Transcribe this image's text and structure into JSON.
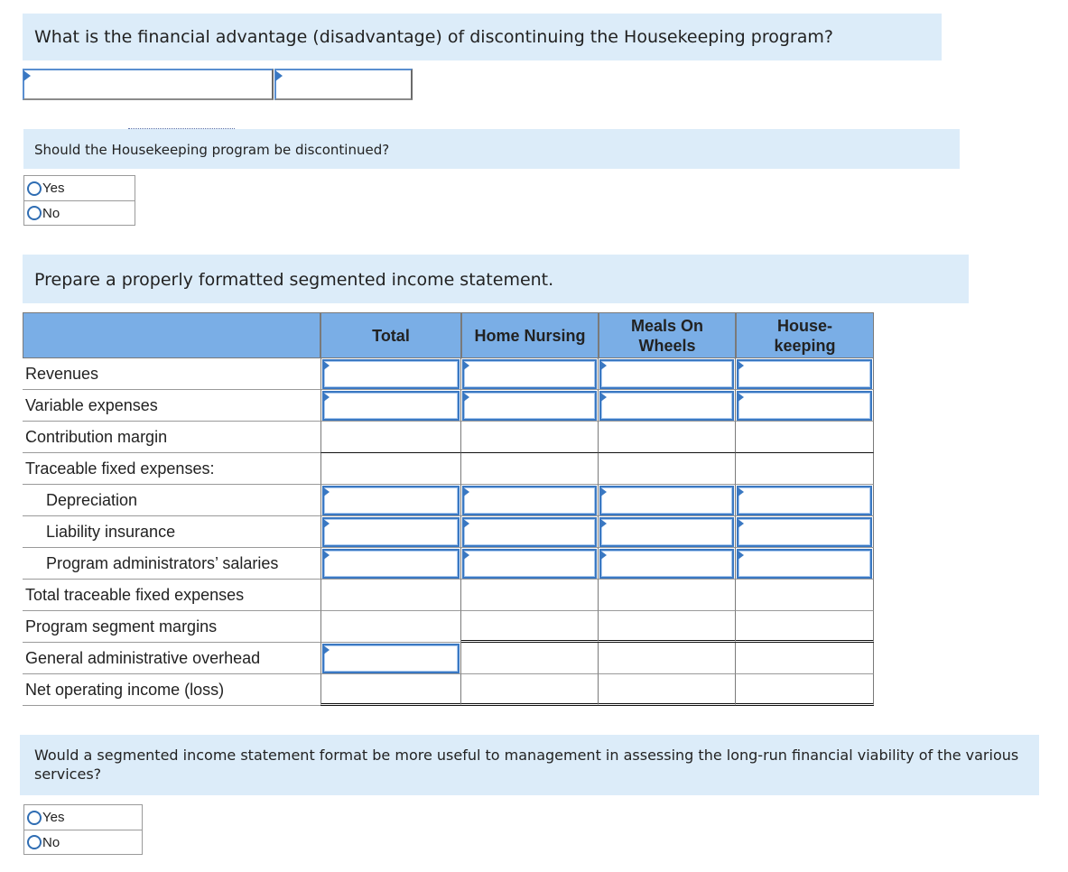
{
  "q1": {
    "prompt": "What is the financial advantage (disadvantage) of discontinuing the Housekeeping program?",
    "label_input_value": "",
    "amount_input_value": ""
  },
  "q2": {
    "prompt": "Should the Housekeeping program be discontinued?",
    "options": [
      {
        "label": "Yes",
        "selected": false
      },
      {
        "label": "No",
        "selected": false
      }
    ]
  },
  "q3": {
    "prompt": "Prepare a properly formatted segmented income statement.",
    "columns": [
      "",
      "Total",
      "Home Nursing",
      "Meals On Wheels",
      "House-keeping"
    ],
    "column_display": [
      "",
      "Total",
      "Home Nursing",
      "Meals On\nWheels",
      "House-\nkeeping"
    ],
    "rows": [
      {
        "label": "Revenues",
        "indent": false,
        "inputs": [
          true,
          true,
          true,
          true
        ],
        "values": [
          "",
          "",
          "",
          ""
        ]
      },
      {
        "label": "Variable expenses",
        "indent": false,
        "inputs": [
          true,
          true,
          true,
          true
        ],
        "values": [
          "",
          "",
          "",
          ""
        ]
      },
      {
        "label": "Contribution margin",
        "indent": false,
        "inputs": [
          false,
          false,
          false,
          false
        ],
        "values": [
          "",
          "",
          "",
          ""
        ]
      },
      {
        "label": "Traceable fixed expenses:",
        "indent": false,
        "inputs": [
          false,
          false,
          false,
          false
        ],
        "values": [
          "",
          "",
          "",
          ""
        ]
      },
      {
        "label": "Depreciation",
        "indent": true,
        "inputs": [
          true,
          true,
          true,
          true
        ],
        "values": [
          "",
          "",
          "",
          ""
        ]
      },
      {
        "label": "Liability insurance",
        "indent": true,
        "inputs": [
          true,
          true,
          true,
          true
        ],
        "values": [
          "",
          "",
          "",
          ""
        ]
      },
      {
        "label": "Program administrators’ salaries",
        "indent": true,
        "inputs": [
          true,
          true,
          true,
          true
        ],
        "values": [
          "",
          "",
          "",
          ""
        ]
      },
      {
        "label": "Total traceable fixed expenses",
        "indent": false,
        "inputs": [
          false,
          false,
          false,
          false
        ],
        "values": [
          "",
          "",
          "",
          ""
        ]
      },
      {
        "label": "Program segment margins",
        "indent": false,
        "inputs": [
          false,
          false,
          false,
          false
        ],
        "values": [
          "",
          "",
          "",
          ""
        ]
      },
      {
        "label": "General administrative overhead",
        "indent": false,
        "inputs": [
          true,
          false,
          false,
          false
        ],
        "values": [
          "",
          "",
          "",
          ""
        ]
      },
      {
        "label": "Net operating income (loss)",
        "indent": false,
        "inputs": [
          false,
          false,
          false,
          false
        ],
        "values": [
          "",
          "",
          "",
          ""
        ]
      }
    ]
  },
  "q4": {
    "prompt": "Would a segmented income statement format be more useful to management in assessing the long-run financial viability of the various services?",
    "options": [
      {
        "label": "Yes",
        "selected": false
      },
      {
        "label": "No",
        "selected": false
      }
    ]
  },
  "colors": {
    "prompt_bg": "#dcecf9",
    "header_bg": "#7aaee6",
    "input_border": "#3a78c2",
    "radio_ring": "#2f6db3"
  }
}
